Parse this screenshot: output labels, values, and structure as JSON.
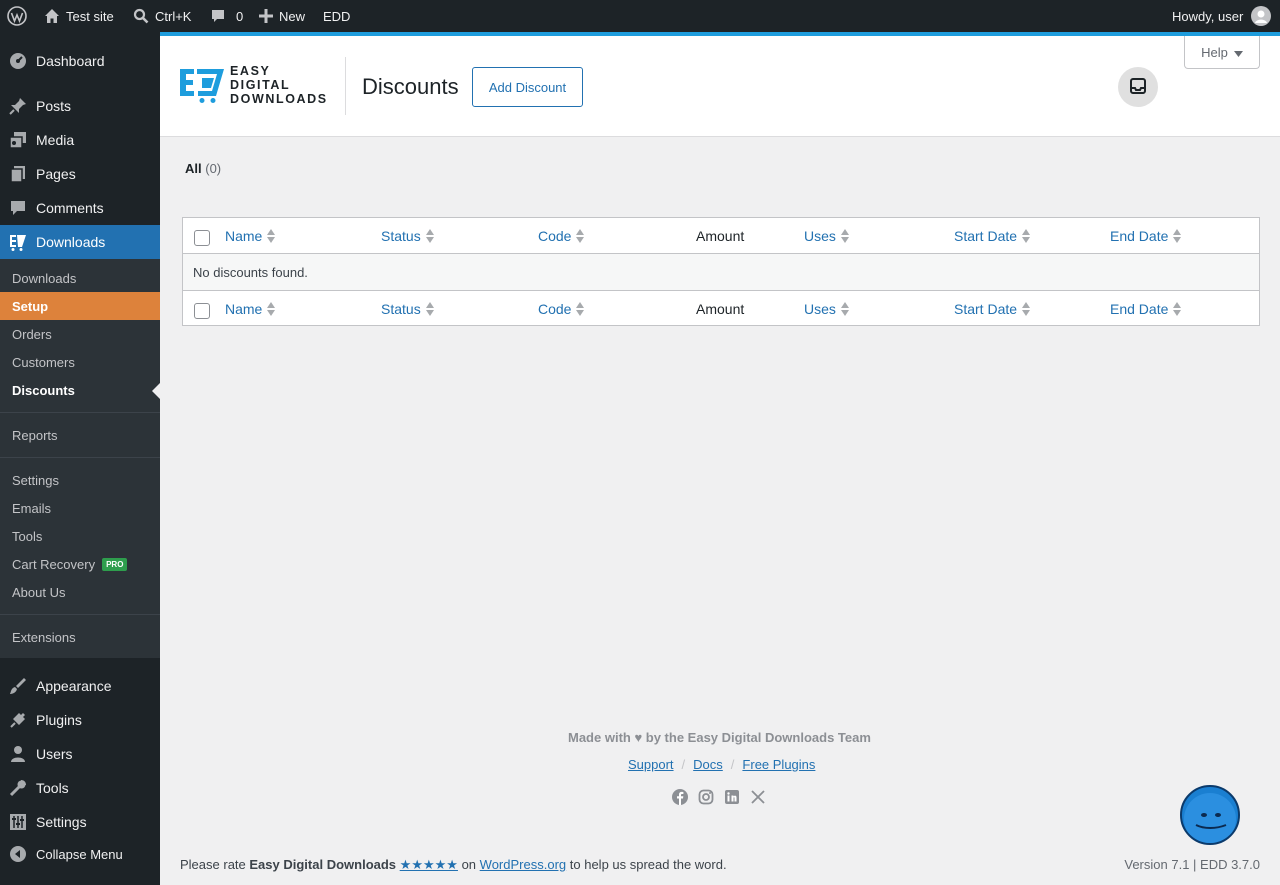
{
  "adminbar": {
    "site_name": "Test site",
    "search_shortcut": "Ctrl+K",
    "comments_count": "0",
    "new_label": "New",
    "edd_label": "EDD",
    "howdy": "Howdy, user"
  },
  "sidebar": {
    "dashboard": "Dashboard",
    "posts": "Posts",
    "media": "Media",
    "pages": "Pages",
    "comments": "Comments",
    "downloads": "Downloads",
    "submenu": {
      "downloads": "Downloads",
      "setup": "Setup",
      "orders": "Orders",
      "customers": "Customers",
      "discounts": "Discounts",
      "reports": "Reports",
      "settings": "Settings",
      "emails": "Emails",
      "tools": "Tools",
      "cart_recovery": "Cart Recovery",
      "pro_badge": "PRO",
      "about_us": "About Us",
      "extensions": "Extensions"
    },
    "appearance": "Appearance",
    "plugins": "Plugins",
    "users": "Users",
    "tools": "Tools",
    "settings": "Settings",
    "collapse": "Collapse Menu"
  },
  "header": {
    "logo_line1": "EASY",
    "logo_line2": "DIGITAL",
    "logo_line3": "DOWNLOADS",
    "title": "Discounts",
    "add_button": "Add Discount",
    "help": "Help"
  },
  "filter": {
    "all_label": "All",
    "all_count": "(0)"
  },
  "table": {
    "columns": [
      "Name",
      "Status",
      "Code",
      "Amount",
      "Uses",
      "Start Date",
      "End Date"
    ],
    "empty_message": "No discounts found."
  },
  "footer": {
    "made_with": "Made with ♥ by the Easy Digital Downloads Team",
    "support": "Support",
    "docs": "Docs",
    "free_plugins": "Free Plugins",
    "sep": "/",
    "rate_prefix": "Please rate",
    "rate_plugin": "Easy Digital Downloads",
    "rate_stars": "★★★★★",
    "rate_on": "on",
    "rate_site": "WordPress.org",
    "rate_suffix": "to help us spread the word.",
    "version": "Version 7.1 | EDD 3.7.0"
  },
  "colors": {
    "accent": "#2271b1",
    "setup_highlight": "#dd823b",
    "header_stripe": "#1e9ddd",
    "admin_dark": "#1d2327"
  }
}
